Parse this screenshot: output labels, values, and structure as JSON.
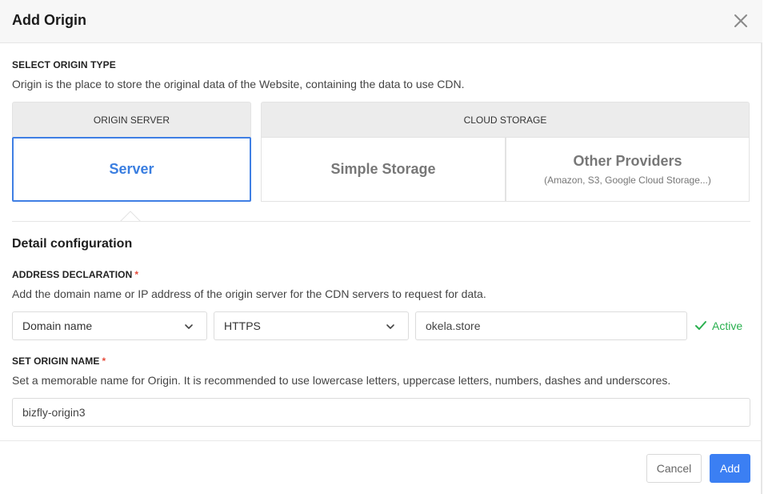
{
  "dialog": {
    "title": "Add Origin"
  },
  "origin_type": {
    "label": "SELECT ORIGIN TYPE",
    "description": "Origin is the place to store the original data of the Website, containing the data to use CDN.",
    "groups": {
      "origin_server": "ORIGIN SERVER",
      "cloud_storage": "CLOUD STORAGE"
    },
    "options": {
      "server": "Server",
      "simple_storage": "Simple Storage",
      "other_providers": "Other Providers",
      "other_providers_sub": "(Amazon, S3, Google Cloud Storage...)"
    },
    "selected": "server"
  },
  "detail": {
    "heading": "Detail configuration",
    "address": {
      "label": "ADDRESS DECLARATION",
      "required_mark": "*",
      "description": "Add the domain name or IP address of the origin server for the CDN servers to request for data.",
      "type_value": "Domain name",
      "protocol_value": "HTTPS",
      "host_value": "okela.store",
      "status": "Active"
    },
    "name": {
      "label": "SET ORIGIN NAME",
      "required_mark": "*",
      "description": "Set a memorable name for Origin. It is recommended to use lowercase letters, uppercase letters, numbers, dashes and underscores.",
      "value": "bizfly-origin3"
    }
  },
  "footer": {
    "cancel_label": "Cancel",
    "add_label": "Add"
  },
  "colors": {
    "accent": "#3b7ff3",
    "success": "#2ab04f",
    "required": "#e74c3c"
  }
}
